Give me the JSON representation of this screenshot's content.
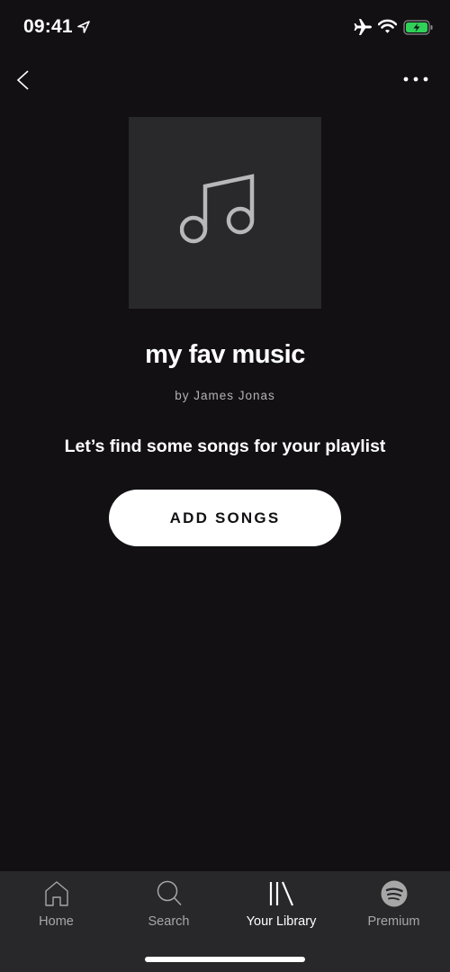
{
  "status_bar": {
    "time": "09:41",
    "icons": [
      "location-arrow-icon",
      "airplane-mode-icon",
      "wifi-icon",
      "battery-charging-icon"
    ],
    "battery_color": "#30d158"
  },
  "nav": {
    "back_icon": "chevron-left-icon",
    "more_icon": "more-horizontal-icon"
  },
  "playlist": {
    "cover_icon": "music-note-icon",
    "title": "my fav music",
    "owner": "by James Jonas",
    "empty_prompt": "Let’s find some songs for your playlist",
    "add_songs_label": "ADD SONGS"
  },
  "tab_bar": {
    "tabs": [
      {
        "label": "Home",
        "icon": "home-icon",
        "active": false
      },
      {
        "label": "Search",
        "icon": "search-icon",
        "active": false
      },
      {
        "label": "Your Library",
        "icon": "library-icon",
        "active": true
      },
      {
        "label": "Premium",
        "icon": "spotify-logo-icon",
        "active": false
      }
    ]
  },
  "colors": {
    "background": "#121013",
    "tab_bar": "#282729",
    "cover": "#29282a",
    "inactive_label": "#a7a7a7"
  }
}
